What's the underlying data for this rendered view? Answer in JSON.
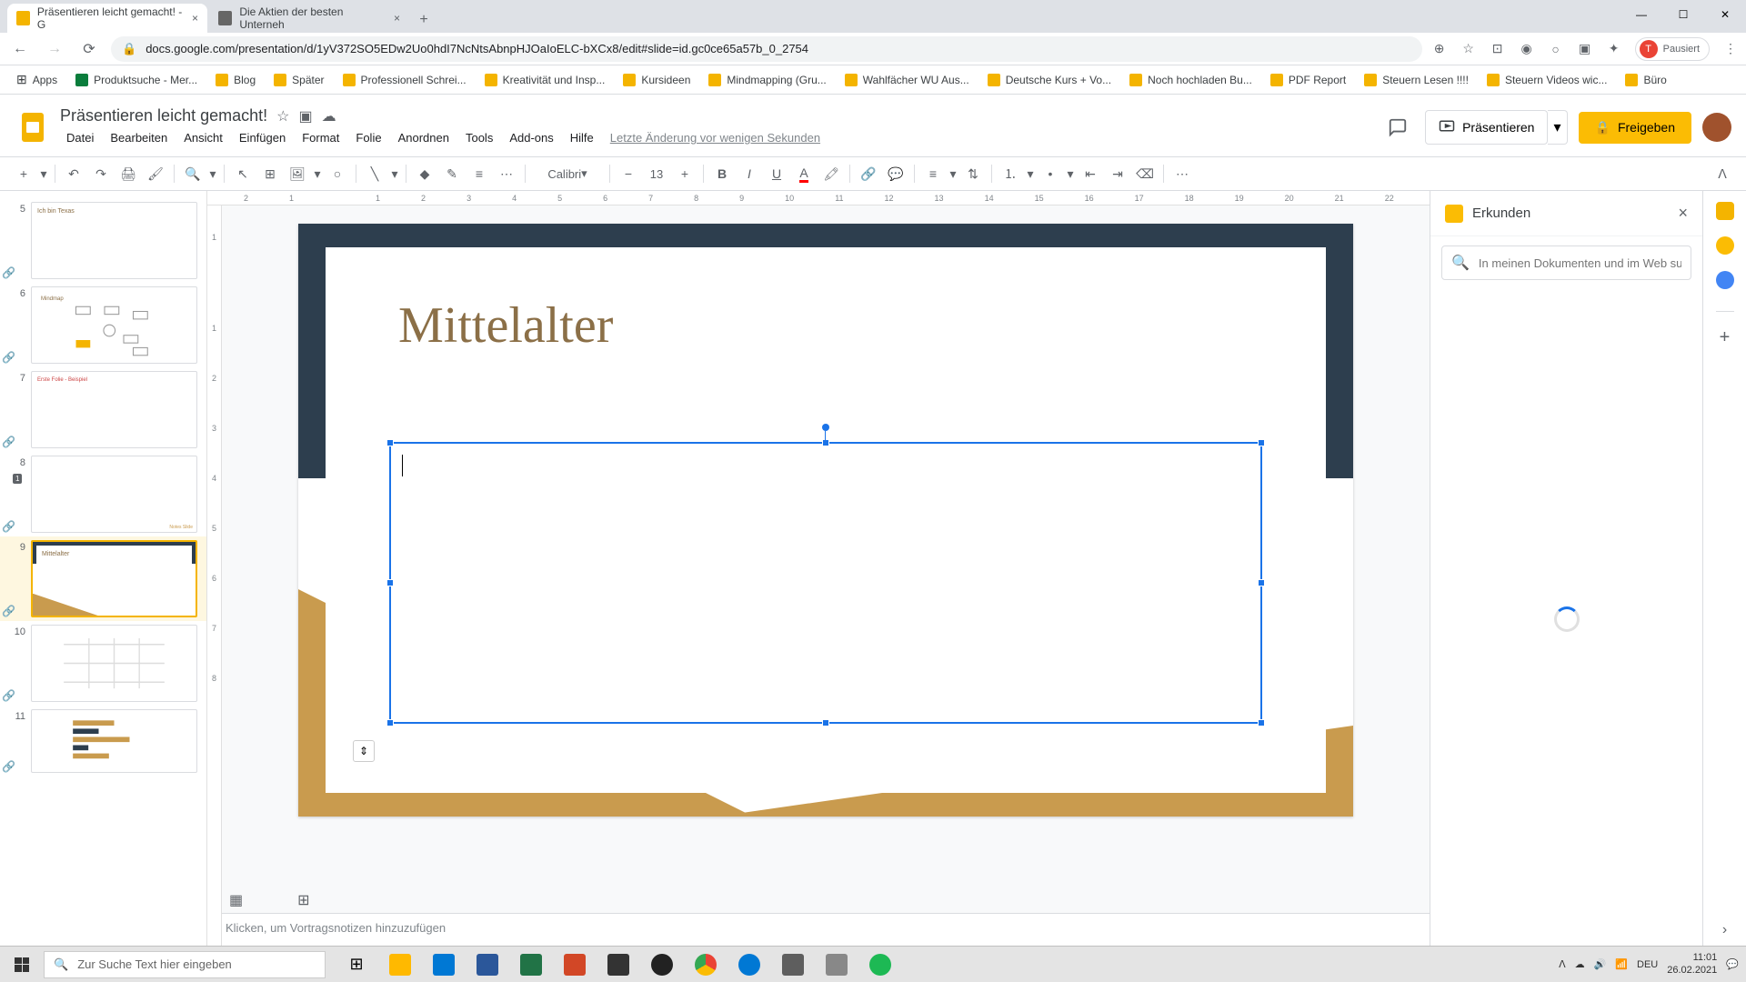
{
  "browser": {
    "tabs": [
      {
        "title": "Präsentieren leicht gemacht! - G",
        "active": true
      },
      {
        "title": "Die Aktien der besten Unterneh",
        "active": false
      }
    ],
    "url": "docs.google.com/presentation/d/1yV372SO5EDw2Uo0hdI7NcNtsAbnpHJOaIoELC-bXCx8/edit#slide=id.gc0ce65a57b_0_2754",
    "profile_status": "Pausiert",
    "profile_letter": "T"
  },
  "bookmarks": {
    "apps": "Apps",
    "items": [
      "Produktsuche - Mer...",
      "Blog",
      "Später",
      "Professionell Schrei...",
      "Kreativität und Insp...",
      "Kursideen",
      "Mindmapping  (Gru...",
      "Wahlfächer WU Aus...",
      "Deutsche Kurs + Vo...",
      "Noch hochladen Bu...",
      "PDF Report",
      "Steuern Lesen !!!!",
      "Steuern Videos wic...",
      "Büro"
    ]
  },
  "doc": {
    "title": "Präsentieren leicht gemacht!",
    "menus": [
      "Datei",
      "Bearbeiten",
      "Ansicht",
      "Einfügen",
      "Format",
      "Folie",
      "Anordnen",
      "Tools",
      "Add-ons",
      "Hilfe"
    ],
    "last_edit": "Letzte Änderung vor wenigen Sekunden",
    "present": "Präsentieren",
    "share": "Freigeben"
  },
  "toolbar": {
    "font": "Calibri",
    "font_size": "13"
  },
  "slide": {
    "title": "Mittelalter"
  },
  "filmstrip": {
    "slides": [
      5,
      6,
      7,
      8,
      9,
      10,
      11
    ],
    "selected": 9
  },
  "ruler_h": [
    "2",
    "1",
    "",
    "1",
    "2",
    "3",
    "4",
    "5",
    "6",
    "7",
    "8",
    "9",
    "10",
    "11",
    "12",
    "13",
    "14",
    "15",
    "16",
    "17",
    "18",
    "19",
    "20",
    "21",
    "22"
  ],
  "ruler_v": [
    "1",
    "",
    "1",
    "2",
    "3",
    "4",
    "5",
    "6",
    "7",
    "8"
  ],
  "speaker_notes": "Klicken, um Vortragsnotizen hinzuzufügen",
  "explore": {
    "title": "Erkunden",
    "search_placeholder": "In meinen Dokumenten und im Web su"
  },
  "taskbar": {
    "search_placeholder": "Zur Suche Text hier eingeben",
    "lang": "DEU",
    "time": "11:01",
    "date": "26.02.2021"
  }
}
